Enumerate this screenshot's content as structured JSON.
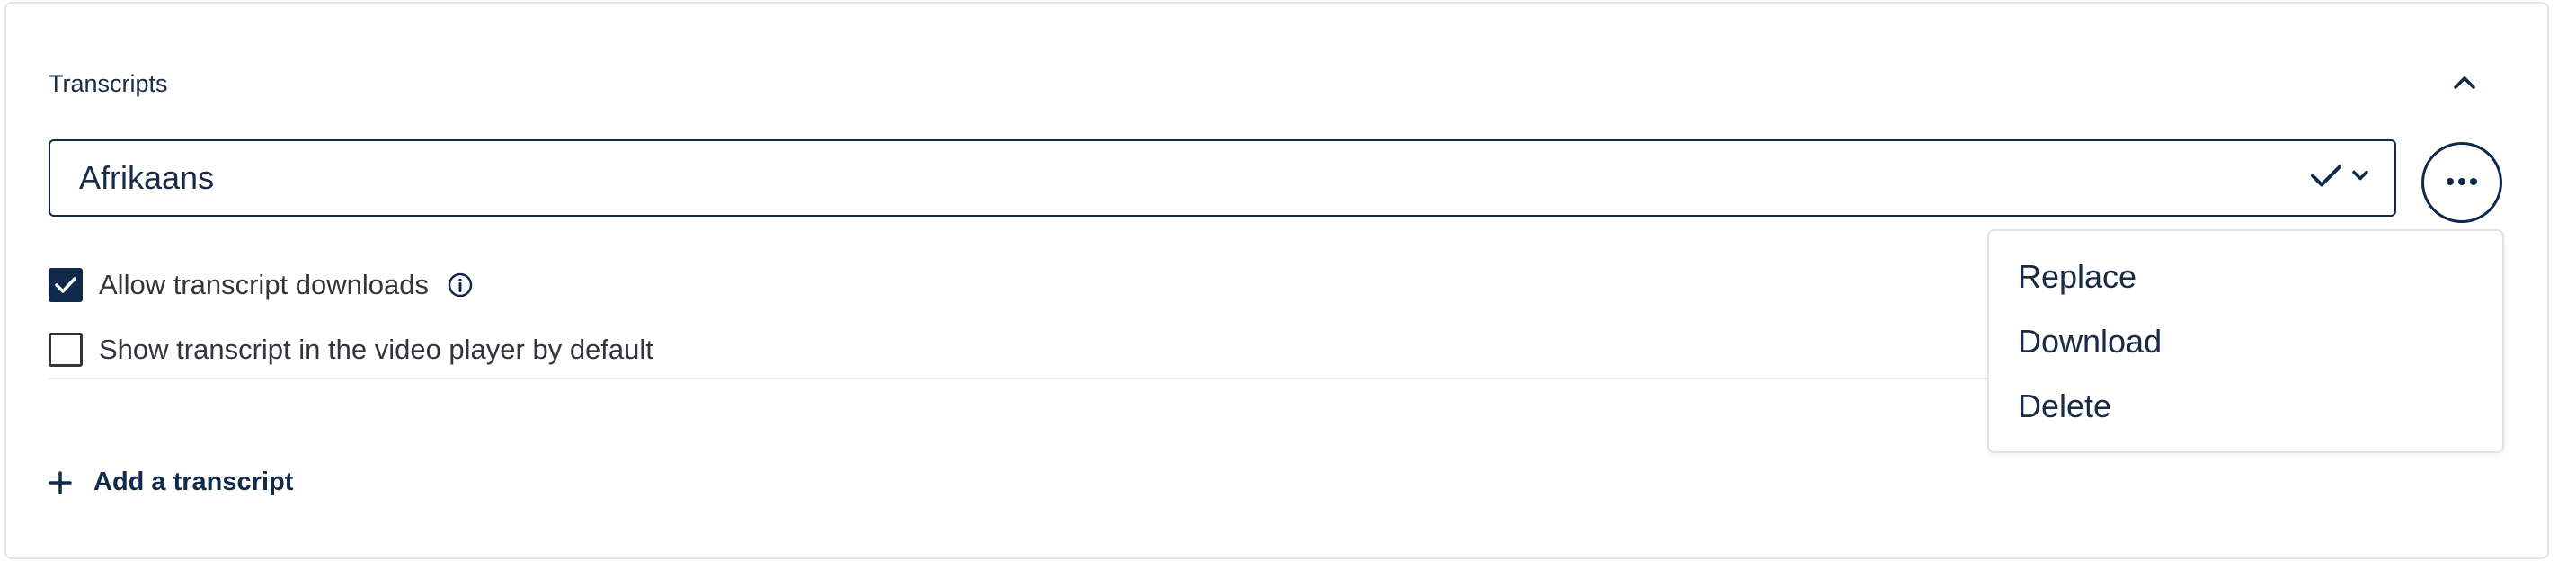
{
  "section": {
    "title": "Transcripts",
    "collapse_icon": "chevron-up-icon"
  },
  "transcript_select": {
    "value": "Afrikaans",
    "status_icon": "check-icon",
    "dropdown_icon": "chevron-down-icon"
  },
  "more_button": {
    "icon": "ellipsis-icon"
  },
  "options": {
    "allow_downloads": {
      "label": "Allow transcript downloads",
      "checked": true,
      "info_icon": "info-icon"
    },
    "show_by_default": {
      "label": "Show transcript in the video player by default",
      "checked": false
    }
  },
  "add_transcript": {
    "label": "Add a transcript",
    "icon": "plus-icon"
  },
  "menu": {
    "items": [
      {
        "label": "Replace"
      },
      {
        "label": "Download"
      },
      {
        "label": "Delete"
      }
    ]
  },
  "colors": {
    "primary": "#0f2a4a",
    "text": "#1a2b45",
    "border": "#e6e6e6"
  }
}
